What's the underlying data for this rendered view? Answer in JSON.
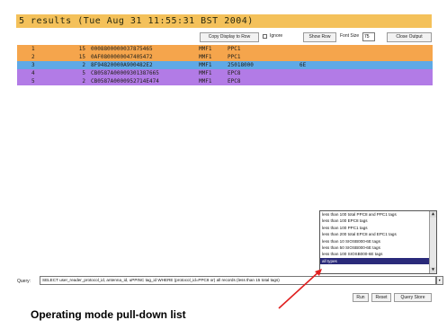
{
  "header": {
    "text": "5 results (Tue Aug 31 11:55:31 BST 2004)"
  },
  "toolbar": {
    "copy_label": "Copy Display to Row",
    "ignore_label": "Ignore",
    "show_row_label": "Show Row",
    "font_size_label": "Font Size",
    "font_size_value": "75",
    "close_output_label": "Close Output"
  },
  "results": [
    {
      "idx": "1",
      "num": "15",
      "id": "0008800000037875465",
      "a": "MMF1",
      "b": "PPC1",
      "c": "",
      "color": "#f5a54c"
    },
    {
      "idx": "2",
      "num": "15",
      "id": "0AF0800000047405472",
      "a": "MMF1",
      "b": "PPC1",
      "c": "",
      "color": "#f5a54c"
    },
    {
      "idx": "3",
      "num": "2",
      "id": "8F94820000A900482E2",
      "a": "MMF1",
      "b": "25018000",
      "c": "6E",
      "color": "#5fa9e6"
    },
    {
      "idx": "4",
      "num": "5",
      "id": "CB0587A00009301387665",
      "a": "MMF1",
      "b": "EPC8",
      "c": "",
      "color": "#b27be6"
    },
    {
      "idx": "5",
      "num": "2",
      "id": "CB0587A0000952714E474",
      "a": "MMF1",
      "b": "EPC8",
      "c": "",
      "color": "#b27be6"
    }
  ],
  "dropdown": {
    "items": [
      "less than 100 total PPC8 and PPC1 tags",
      "less than 100 EPC8 tags",
      "less than 100 PPC1 tags",
      "less than 200 total EPC8 and EPC1 tags",
      "less than 10 SIOSB000-6E tags",
      "less than 50 SIOSB000-6E tags",
      "less than 100 SIOSB000-6E tags",
      "all types"
    ],
    "selected_index": 7
  },
  "query": {
    "label": "Query:",
    "value": "SELECT user_reader_protocol_id, antenna_id, uPPINC tag_id WHERE (protocol_id=PPC8 or) all records (less than 15 total tags)"
  },
  "buttons": {
    "run": "Run",
    "reset": "Reset",
    "query_store": "Query Store"
  },
  "caption": "Operating mode pull-down list",
  "colors": {
    "header": "#f4c15a",
    "orange_row": "#f5a54c",
    "blue_row": "#5fa9e6",
    "purple_row": "#b27be6",
    "arrow": "#e02020"
  }
}
